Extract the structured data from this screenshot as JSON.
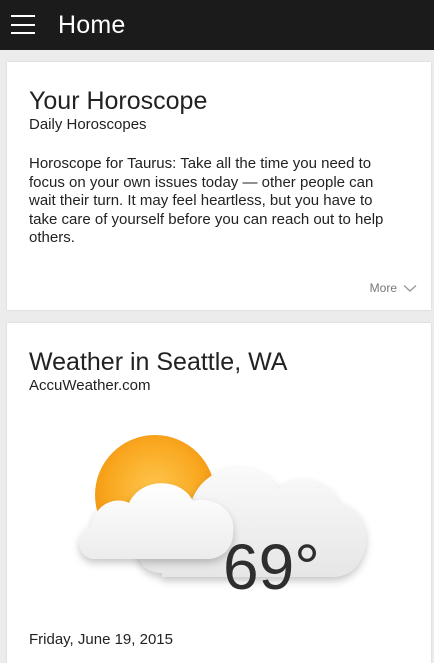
{
  "appbar": {
    "menu_icon": "hamburger-menu-icon",
    "title": "Home"
  },
  "horoscope_card": {
    "title": "Your Horoscope",
    "subtitle": "Daily Horoscopes",
    "body": "Horoscope for Taurus: Take all the time you need to focus on your own issues today — other people can wait their turn. It may feel heartless, but you have to take care of yourself before you can reach out to help others.",
    "more_label": "More",
    "more_icon": "chevron-down-icon"
  },
  "weather_card": {
    "title": "Weather in Seattle, WA",
    "subtitle": "AccuWeather.com",
    "condition_icon": "partly-cloudy-icon",
    "temperature": "69°",
    "date": "Friday, June 19, 2015"
  },
  "colors": {
    "appbar_bg": "#1b1b1b",
    "page_bg": "#ececec",
    "sun": "#f7a21c"
  }
}
